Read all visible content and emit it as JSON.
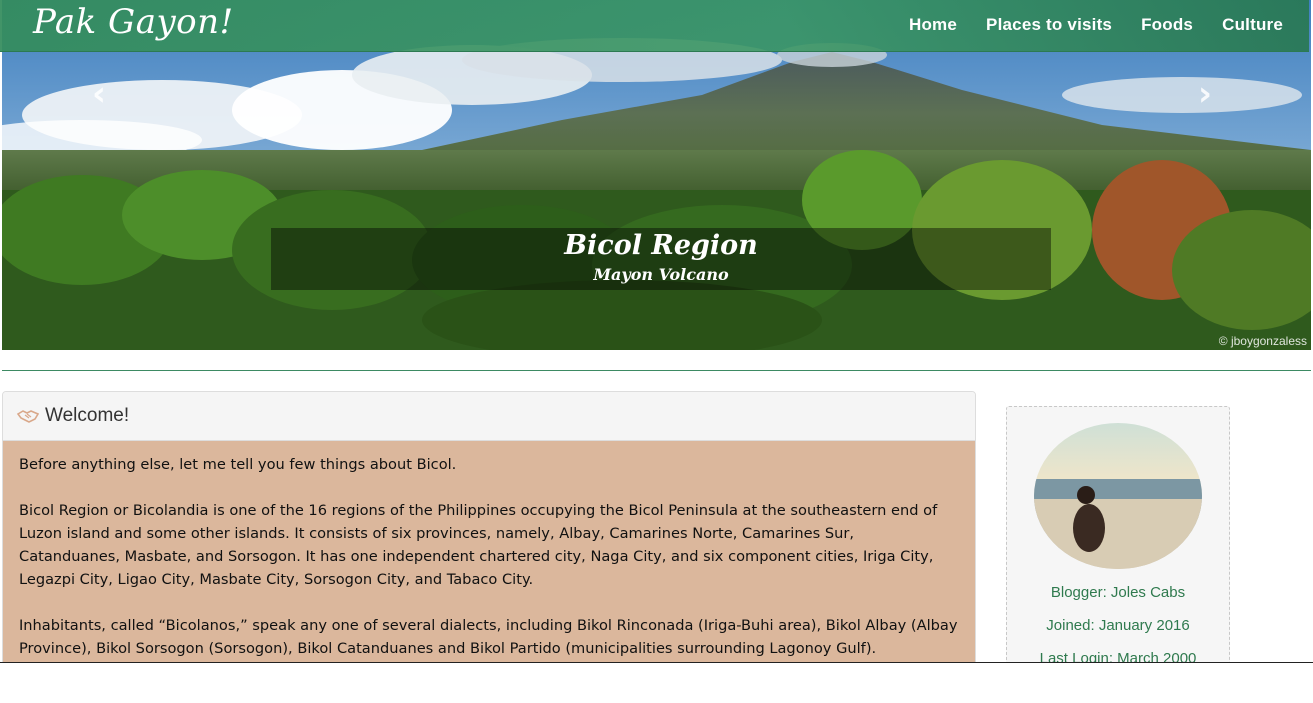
{
  "brand": "Pak Gayon!",
  "nav": {
    "home": "Home",
    "places": "Places to visits",
    "foods": "Foods",
    "culture": "Culture"
  },
  "carousel": {
    "title": "Bicol Region",
    "subtitle": "Mayon Volcano",
    "watermark": "© jboygonzaless",
    "prev_icon": "chevron-left-icon",
    "next_icon": "chevron-right-icon"
  },
  "welcome": {
    "icon": "handshake-icon",
    "title": "Welcome!",
    "paragraphs": [
      "Before anything else, let me tell you few things about Bicol.",
      "Bicol Region or Bicolandia is one of the 16 regions of the Philippines occupying the Bicol Peninsula at the southeastern end of Luzon island and some other islands. It consists of six provinces, namely, Albay, Camarines Norte, Camarines Sur, Catanduanes, Masbate, and Sorsogon. It has one independent chartered city, Naga City, and six component cities, Iriga City, Legazpi City, Ligao City, Masbate City, Sorsogon City, and Tabaco City.",
      "Inhabitants, called “Bicolanos,” speak any one of several dialects, including Bikol Rinconada (Iriga-Buhi area), Bikol Albay (Albay Province), Bikol Sorsogon (Sorsogon), Bikol Catanduanes and Bikol Partido (municipalities surrounding Lagonoy Gulf)."
    ]
  },
  "profile": {
    "blogger": "Blogger: Joles Cabs",
    "joined": "Joined: January 2016",
    "last_login": "Last Login: March 2000"
  },
  "colors": {
    "nav_green": "#3a965f",
    "panel_body": "#dbb79c",
    "profile_text": "#2f7a4e"
  }
}
